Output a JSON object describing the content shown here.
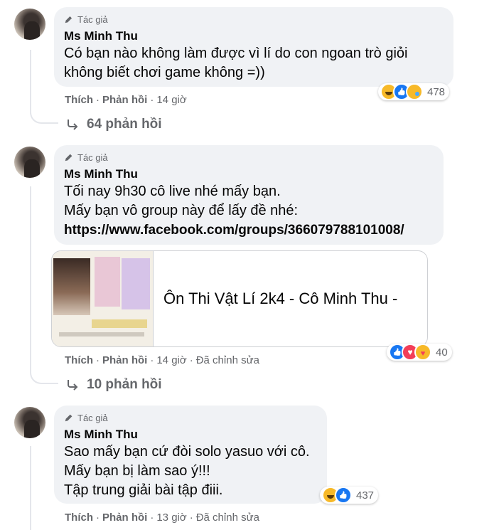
{
  "comments": [
    {
      "author_tag": "Tác giả",
      "author": "Ms Minh Thu",
      "lines": [
        "Có bạn nào không làm được vì lí do con ngoan trò giỏi",
        "không biết chơi game không =))"
      ],
      "actions": {
        "like": "Thích",
        "reply": "Phản hồi",
        "time": "14 giờ",
        "edited": ""
      },
      "reaction_icons": [
        "haha",
        "like",
        "sad"
      ],
      "reaction_count": "478",
      "replies_label": "64 phản hồi"
    },
    {
      "author_tag": "Tác giả",
      "author": "Ms Minh Thu",
      "lines": [
        "Tối nay 9h30 cô live nhé mấy bạn.",
        "Mấy bạn vô group này để lấy đề nhé:"
      ],
      "link": "https://www.facebook.com/groups/366079788101008/",
      "link_card": {
        "title": "Ôn Thi Vật Lí 2k4 - Cô Minh Thu -"
      },
      "actions": {
        "like": "Thích",
        "reply": "Phản hồi",
        "time": "14 giờ",
        "edited": "Đã chỉnh sửa"
      },
      "reaction_icons": [
        "like",
        "love",
        "care"
      ],
      "reaction_count": "40",
      "replies_label": "10 phản hồi"
    },
    {
      "author_tag": "Tác giả",
      "author": "Ms Minh Thu",
      "lines": [
        "Sao mấy bạn cứ đòi solo yasuo với cô.",
        "Mấy bạn bị làm sao ý!!!",
        "Tập trung giải bài tập điii."
      ],
      "actions": {
        "like": "Thích",
        "reply": "Phản hồi",
        "time": "13 giờ",
        "edited": "Đã chỉnh sửa"
      },
      "reaction_icons": [
        "haha",
        "like"
      ],
      "reaction_count": "437"
    }
  ],
  "icons": {
    "author_tag": "pencil-icon",
    "replies": "reply-arrow-icon"
  }
}
